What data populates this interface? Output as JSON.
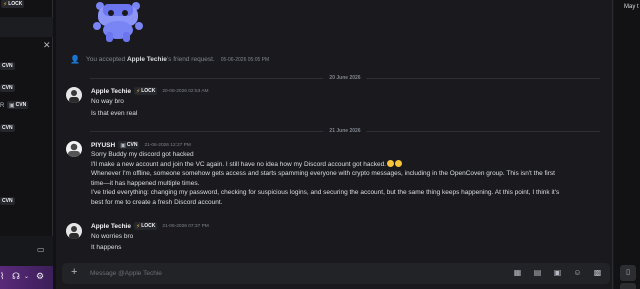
{
  "sidebar": {
    "tags": [
      {
        "icon": "⚡",
        "text": "LOCK"
      },
      {
        "icon": "▣",
        "text": "CVN"
      },
      {
        "icon": "▣",
        "text": "CVN"
      },
      {
        "icon": "▣",
        "text": "CVN"
      },
      {
        "icon": "▣",
        "text": "CVN"
      },
      {
        "icon": "▣",
        "text": "CVN"
      }
    ],
    "partial_letter": "R"
  },
  "right_panel": {
    "label": "May t"
  },
  "system_message": {
    "prefix": "You accepted ",
    "name": "Apple Techie",
    "suffix": "'s friend request.",
    "timestamp": "05-06-2026 05:05 PM"
  },
  "date_separators": [
    "20 June 2026",
    "21 June 2026"
  ],
  "messages": [
    {
      "author": "Apple Techie",
      "tag": {
        "icon": "⚡",
        "text": "LOCK"
      },
      "timestamp": "20-06-2026 02:53 AM",
      "lines": [
        "No way bro",
        "Is that even real"
      ]
    },
    {
      "author": "PIYUSH",
      "tag": {
        "icon": "▣",
        "text": "CVN"
      },
      "timestamp": "21-06-2026 12:27 PM",
      "lines": [
        "Sorry Buddy my discord got hacked",
        "I'll make a new account and join the VC again. I still have no idea how my Discord account got hacked.",
        "Whenever I'm offline, someone somehow gets access and starts spamming everyone with crypto messages, including in the OpenCoven group. This isn't the first",
        "time—it has happened multiple times.",
        "I've tried everything: changing my password, checking for suspicious logins, and securing the account, but the same thing keeps happening. At this point, I think it's",
        "best for me to create a fresh Discord account."
      ]
    },
    {
      "author": "Apple Techie",
      "tag": {
        "icon": "⚡",
        "text": "LOCK"
      },
      "timestamp": "21-06-2026 07:37 PM",
      "lines": [
        "No worries bro",
        "It happens"
      ]
    }
  ],
  "composer": {
    "placeholder": "Message @Apple Techie",
    "icons": [
      "gift-icon",
      "gif-icon",
      "sticker-icon",
      "emoji-icon",
      "apps-icon"
    ]
  },
  "colors": {
    "background": "#1a1a1e",
    "sidebar": "#121214",
    "accent_green": "#23a55a",
    "lock_yellow": "#e3b341",
    "mascot_blue": "#7984f5"
  }
}
